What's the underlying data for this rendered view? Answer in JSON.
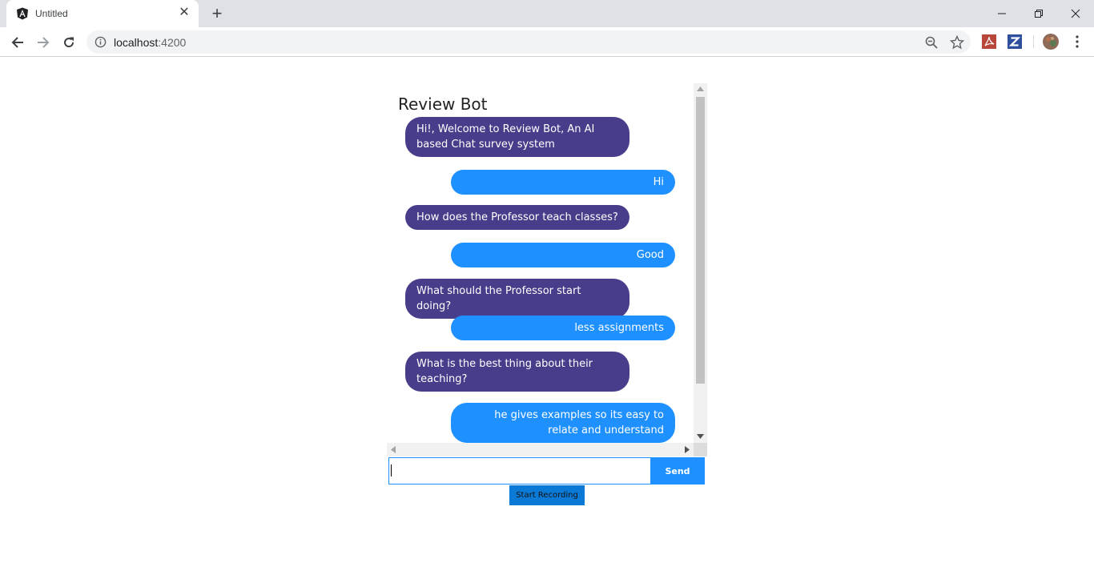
{
  "browser": {
    "tab_title": "Untitled",
    "address_host": "localhost",
    "address_port": ":4200"
  },
  "chat": {
    "title": "Review Bot",
    "messages": [
      {
        "sender": "bot",
        "text": "Hi!, Welcome to Review Bot, An AI based Chat survey system"
      },
      {
        "sender": "user",
        "text": "Hi"
      },
      {
        "sender": "bot",
        "text": "How does the Professor teach classes?"
      },
      {
        "sender": "user",
        "text": "Good"
      },
      {
        "sender": "bot",
        "text": "What should the Professor start doing?"
      },
      {
        "sender": "user",
        "text": "less assignments"
      },
      {
        "sender": "bot",
        "text": "What is the best thing about their teaching?"
      },
      {
        "sender": "user",
        "text": "he gives examples so its easy to relate and understand"
      }
    ],
    "input_value": "",
    "send_label": "Send",
    "record_label": "Start Recording"
  },
  "colors": {
    "bot_bubble": "#483d8b",
    "user_bubble": "#1e90ff",
    "send_button": "#1e90ff",
    "record_button": "#0b7ad6"
  },
  "icons": {
    "tab_favicon": "angular-logo-icon",
    "tab_close": "close-icon",
    "new_tab": "plus-icon",
    "back": "back-arrow-icon",
    "forward": "forward-arrow-icon",
    "reload": "reload-icon",
    "site_info": "info-icon",
    "zoom": "zoom-out-icon",
    "bookmark": "star-icon",
    "ext_pdf": "acrobat-extension-icon",
    "ext_z": "zotero-extension-icon",
    "profile": "profile-avatar",
    "menu": "kebab-menu-icon"
  }
}
